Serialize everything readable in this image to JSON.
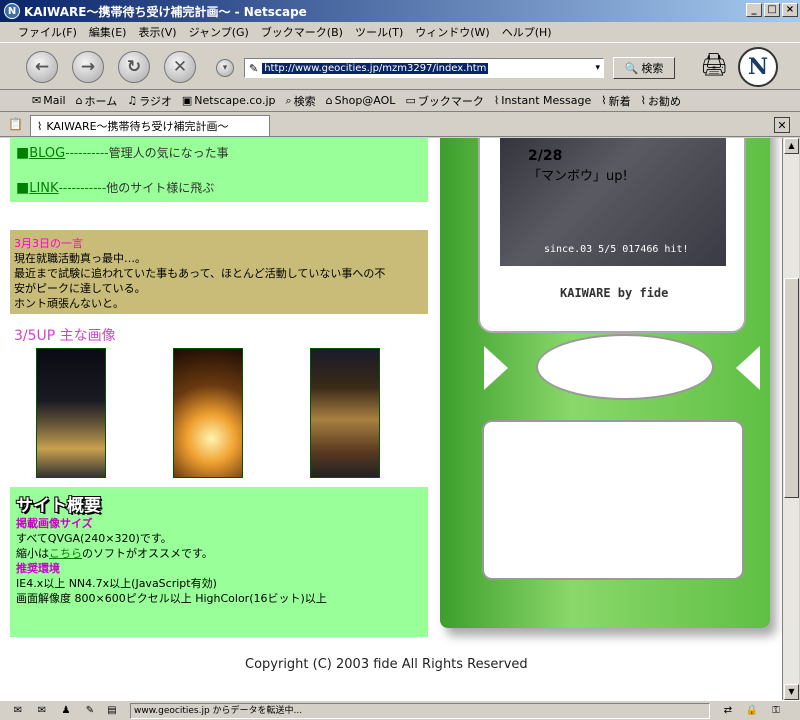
{
  "window": {
    "title": "KAIWARE～携帯待ち受け補完計画～ - Netscape",
    "app_icon": "N"
  },
  "menu": [
    "ファイル(F)",
    "編集(E)",
    "表示(V)",
    "ジャンプ(G)",
    "ブックマーク(B)",
    "ツール(T)",
    "ウィンドウ(W)",
    "ヘルプ(H)"
  ],
  "toolbar": {
    "url": "http://www.geocities.jp/mzm3297/index.htm",
    "search_label": "検索"
  },
  "personal_toolbar": [
    "Mail",
    "ホーム",
    "ラジオ",
    "Netscape.co.jp",
    "検索",
    "Shop@AOL",
    "ブックマーク",
    "Instant Message",
    "新着",
    "お勧め"
  ],
  "tab": {
    "label": "KAIWARE～携帯待ち受け補完計画～"
  },
  "page": {
    "nav": [
      {
        "link": "BLOG",
        "dashes": "----------",
        "desc": "管理人の気になった事"
      },
      {
        "link": "LINK",
        "dashes": "-----------",
        "desc": "他のサイト様に飛ぶ"
      }
    ],
    "note": {
      "title": "3月3日の一言",
      "body1": "現在就職活動真っ最中…。",
      "body2": "最近まで試験に追われていた事もあって、ほとんど活動していない事への不",
      "body3": "安がピークに達している。",
      "body4": "ホント頑張んないと。"
    },
    "photos_title": "3/5UP 主な画像",
    "overview": {
      "heading": "サイト概要",
      "size_label": "掲載画像サイズ",
      "size_text": "すべてQVGA(240×320)です。",
      "shrink_pre": "縮小は",
      "shrink_link": "こちら",
      "shrink_post": "のソフトがオススメです。",
      "env_label": "推奨環境",
      "env1": "IE4.x以上 NN4.7x以上(JavaScript有効)",
      "env2": "画面解像度 800×600ピクセル以上 HighColor(16ビット)以上"
    },
    "copyright": "Copyright (C) 2003 fide All Rights Reserved"
  },
  "phone": {
    "date": "2/28",
    "caption": "「マンボウ」up!",
    "since": "since.03 5/5 017466 hit!",
    "brand": "KAIWARE by fide"
  },
  "status": {
    "text": "www.geocities.jp からデータを転送中..."
  }
}
